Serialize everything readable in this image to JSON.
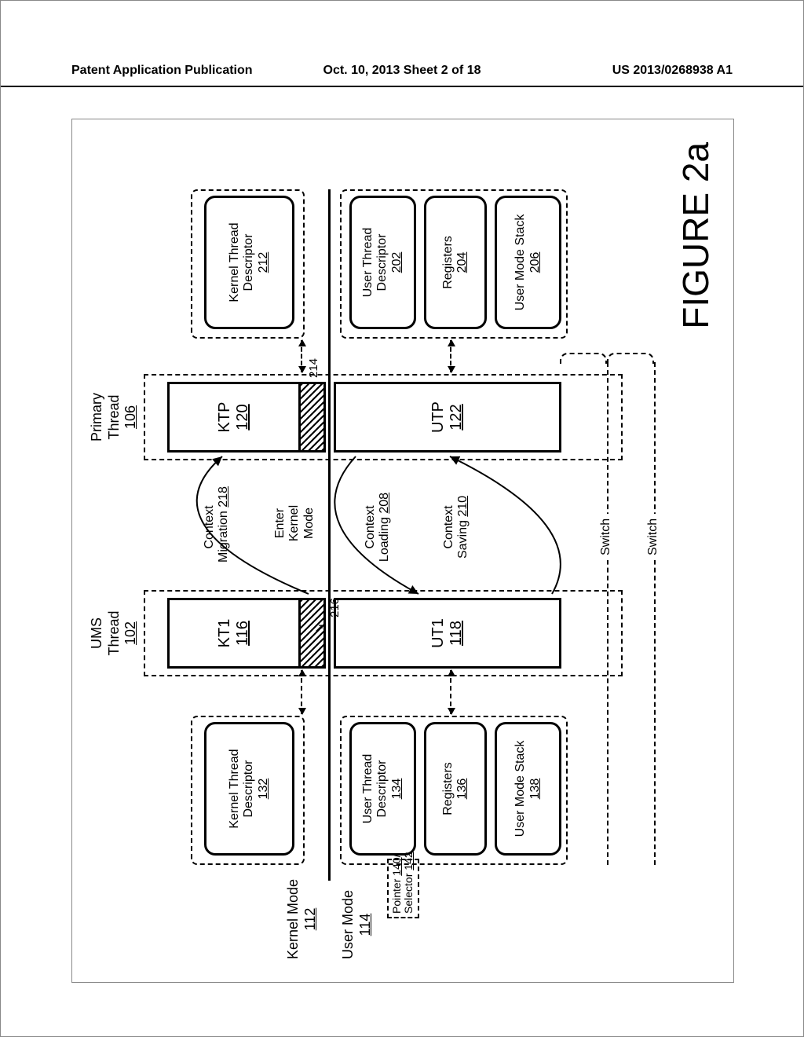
{
  "header": {
    "left": "Patent Application Publication",
    "center": "Oct. 10, 2013  Sheet 2 of 18",
    "right": "US 2013/0268938 A1"
  },
  "figure_label": "FIGURE 2a",
  "modes": {
    "kernel": {
      "label": "Kernel Mode",
      "num": "112"
    },
    "user": {
      "label": "User Mode",
      "num": "114"
    }
  },
  "threads": {
    "ums": {
      "label": "UMS\nThread",
      "num": "102"
    },
    "primary": {
      "label": "Primary\nThread",
      "num": "106"
    }
  },
  "kt_ut": {
    "kt1": {
      "label": "KT1",
      "num": "116"
    },
    "ut1": {
      "label": "UT1",
      "num": "118"
    },
    "ktp": {
      "label": "KTP",
      "num": "120"
    },
    "utp": {
      "label": "UTP",
      "num": "122"
    }
  },
  "left_group": {
    "ktd": {
      "label": "Kernel Thread\nDescriptor",
      "num": "132"
    },
    "utd": {
      "label": "User Thread\nDescriptor",
      "num": "134"
    },
    "reg": {
      "label": "Registers",
      "num": "136"
    },
    "ums": {
      "label": "User Mode Stack",
      "num": "138"
    }
  },
  "right_group": {
    "ktd": {
      "label": "Kernel Thread\nDescriptor",
      "num": "212"
    },
    "utd": {
      "label": "User Thread\nDescriptor",
      "num": "202"
    },
    "reg": {
      "label": "Registers",
      "num": "204"
    },
    "ums": {
      "label": "User Mode Stack",
      "num": "206"
    }
  },
  "pointer_selector": {
    "pointer": {
      "label": "Pointer",
      "num": "140"
    },
    "selector": {
      "label": "Selector",
      "num": "142"
    }
  },
  "actions": {
    "context_migration": {
      "label": "Context\nMigration",
      "num": "218"
    },
    "enter_kernel": {
      "label": "Enter\nKernel\nMode",
      "num": ""
    },
    "context_loading": {
      "label": "Context\nLoading",
      "num": "208"
    },
    "context_saving": {
      "label": "Context\nSaving",
      "num": "210"
    }
  },
  "callouts": {
    "c216": "216",
    "c214": "214"
  },
  "switch_label": "Switch"
}
